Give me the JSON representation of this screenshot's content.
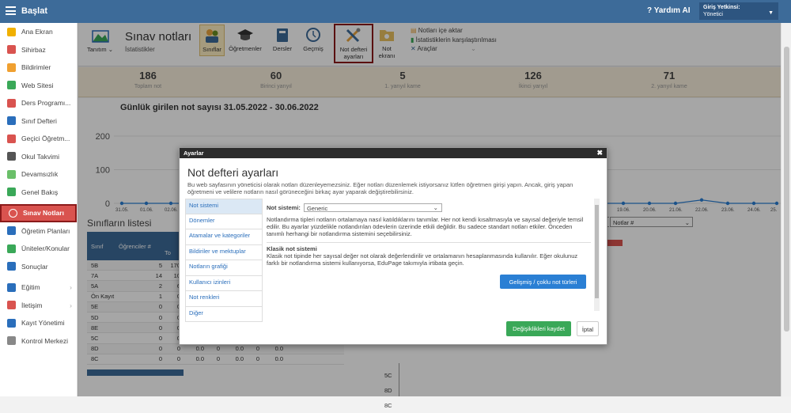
{
  "topbar": {
    "title": "Başlat",
    "help": "Yardım AI",
    "user_label": "Giriş Yetkinsi:",
    "user_role": "Yönetici"
  },
  "sidebar": {
    "items": [
      {
        "label": "Ana Ekran",
        "color": "#f0b000"
      },
      {
        "label": "Sihirbaz",
        "color": "#d9534f"
      },
      {
        "label": "Bildirimler",
        "color": "#f0a030"
      },
      {
        "label": "Web Sitesi",
        "color": "#3aa858"
      },
      {
        "label": "Ders Programı...",
        "color": "#d9534f"
      },
      {
        "label": "Sınıf Defteri",
        "color": "#2a6ebb"
      },
      {
        "label": "Geçici Öğretm...",
        "color": "#d9534f"
      },
      {
        "label": "Okul Takvimi",
        "color": "#555"
      },
      {
        "label": "Devamsızlık",
        "color": "#6abf69"
      },
      {
        "label": "Genel Bakış",
        "color": "#3aa858"
      },
      {
        "label": "Sınav Notları",
        "color": "#fff"
      },
      {
        "label": "Öğretim Planları",
        "color": "#2a6ebb"
      },
      {
        "label": "Üniteler/Konular",
        "color": "#3aa858"
      },
      {
        "label": "Sonuçlar",
        "color": "#2a6ebb"
      },
      {
        "label": "Eğitim",
        "color": "#2a6ebb"
      },
      {
        "label": "İletişim",
        "color": "#d9534f"
      },
      {
        "label": "Kayıt Yönetimi",
        "color": "#2a6ebb"
      },
      {
        "label": "Kontrol Merkezi",
        "color": "#888"
      }
    ]
  },
  "toolbar": {
    "tanitim": "Tanıtım",
    "page_title": "Sınav notları",
    "page_sub": "İstatistikler",
    "buttons": [
      "Sınıflar",
      "Öğretmenler",
      "Dersler",
      "Geçmiş",
      "Not defteri ayarları",
      "Not ekranı"
    ],
    "right": [
      "Notları içe aktar",
      "İstatistiklerin karşılaştırılması",
      "Araçlar"
    ]
  },
  "stats": [
    {
      "n": "186",
      "l": "Toplam not"
    },
    {
      "n": "60",
      "l": "Birinci yarıyıl"
    },
    {
      "n": "5",
      "l": "1. yarıyıl kame"
    },
    {
      "n": "126",
      "l": "İkinci yarıyıl"
    },
    {
      "n": "71",
      "l": "2. yarıyıl kame"
    }
  ],
  "chart_data": {
    "type": "line",
    "title": "Günlük girilen not sayısı 31.05.2022 - 30.06.2022",
    "yticks": [
      "200",
      "100",
      "0"
    ],
    "x": [
      "31.05.",
      "01.06.",
      "02.06.",
      "19.06.",
      "20.06.",
      "21.06.",
      "22.06.",
      "23.06.",
      "24.06.",
      "25."
    ],
    "values": [
      0,
      0,
      0,
      0,
      0,
      0,
      10,
      0,
      0,
      0
    ],
    "ylim": [
      0,
      200
    ]
  },
  "table": {
    "title": "Sınıfların listesi",
    "headers": [
      "Sınıf",
      "Öğrenciler #",
      "To"
    ],
    "rows": [
      [
        "5B",
        "5",
        "170"
      ],
      [
        "7A",
        "14",
        "10"
      ],
      [
        "5A",
        "2",
        "6"
      ],
      [
        "Ön Kayıt",
        "1",
        "0"
      ],
      [
        "5E",
        "0",
        "0"
      ],
      [
        "5D",
        "0",
        "0"
      ],
      [
        "8E",
        "0",
        "0"
      ],
      [
        "5C",
        "0",
        "0"
      ],
      [
        "8D",
        "0",
        "0"
      ],
      [
        "8C",
        "0",
        "0"
      ]
    ],
    "rest": [
      "0.0",
      "0",
      "0.0",
      "0",
      "0.0"
    ],
    "select_label": "Notlar #",
    "side_labels": [
      "5C",
      "8D",
      "8C"
    ]
  },
  "dialog": {
    "header": "Ayarlar",
    "title": "Not defteri ayarları",
    "desc": "Bu web sayfasının yöneticisi olarak notları düzenleyemezsiniz. Eğer notları düzenlemek istiyorsanız lütfen öğretmen girişi yapın. Ancak, giriş yapan öğretmeni ve velilere notların nasıl görüneceğini birkaç ayar yaparak değiştirebilirsiniz.",
    "nav": [
      "Not sistemi",
      "Dönemler",
      "Atamalar ve kategoriler",
      "Bildiriler ve mektuplar",
      "Notların grafiği",
      "Kullanıcı izinleri",
      "Not renkleri",
      "Diğer"
    ],
    "field_label": "Not sistemi:",
    "field_value": "Generic",
    "p1": "Notlandırma tipleri notların ortalamaya nasıl katıldıklarını tanımlar. Her not kendi kısaltmasıyla ve sayısal değeriyle temsil edilir. Bu ayarlar yüzdelikle notlandırılan ödevlerin üzerinde etkili değildir. Bu sadece standart notları etkiler. Önceden tanımlı herhangi bir notlandırma sistemini seçebilirsiniz.",
    "h2": "Klasik not sistemi",
    "p2": "Klasik not tipinde her sayısal değer not olarak değerlendirilir ve ortalamanın hesaplanmasında kullanılır. Eğer okulunuz farklı bir notlandırma sistemi kullanıyorsa, EduPage takımıyla irtibata geçin.",
    "advanced": "Gelişmiş / çoklu not türleri",
    "save": "Değişiklikleri kaydet",
    "cancel": "İptal"
  }
}
